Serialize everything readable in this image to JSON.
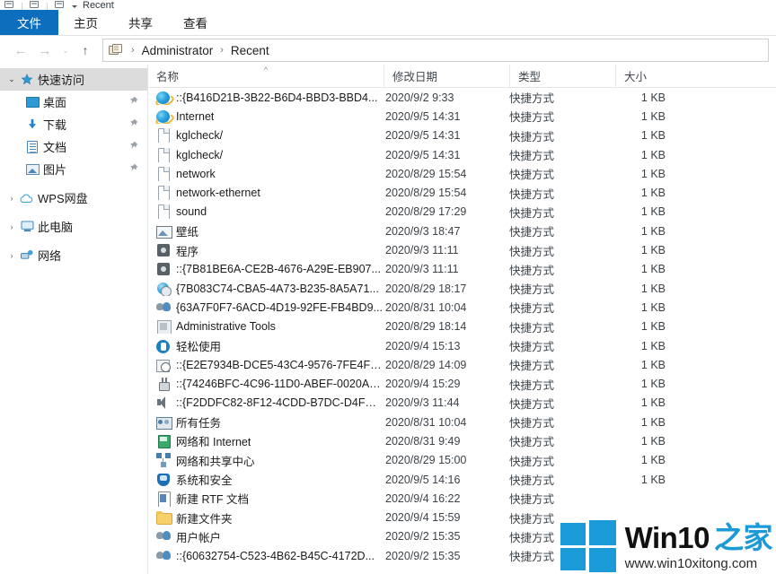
{
  "titlebar": {
    "window_title": "Recent",
    "qat_dropdown": "▾"
  },
  "ribbon": {
    "tabs": [
      {
        "label": "文件",
        "active": true
      },
      {
        "label": "主页",
        "active": false
      },
      {
        "label": "共享",
        "active": false
      },
      {
        "label": "查看",
        "active": false
      }
    ]
  },
  "addressbar": {
    "back": "←",
    "forward": "→",
    "recent_dropdown": "⌄",
    "up": "↑",
    "breadcrumbs": [
      "Administrator",
      "Recent"
    ],
    "separator": "›"
  },
  "sidebar": {
    "items": [
      {
        "label": "快速访问",
        "icon": "star-icon",
        "chevron": "⌄",
        "level": 0,
        "selected": true,
        "pinned": false
      },
      {
        "label": "桌面",
        "icon": "desktop-icon",
        "chevron": "",
        "level": 1,
        "selected": false,
        "pinned": true
      },
      {
        "label": "下载",
        "icon": "download-icon",
        "chevron": "",
        "level": 1,
        "selected": false,
        "pinned": true
      },
      {
        "label": "文档",
        "icon": "document-icon",
        "chevron": "",
        "level": 1,
        "selected": false,
        "pinned": true
      },
      {
        "label": "图片",
        "icon": "pictures-icon",
        "chevron": "",
        "level": 1,
        "selected": false,
        "pinned": true
      },
      {
        "label": "WPS网盘",
        "icon": "cloud-icon",
        "chevron": "›",
        "level": 0,
        "selected": false,
        "pinned": false
      },
      {
        "label": "此电脑",
        "icon": "this-pc-icon",
        "chevron": "›",
        "level": 0,
        "selected": false,
        "pinned": false
      },
      {
        "label": "网络",
        "icon": "network-icon",
        "chevron": "›",
        "level": 0,
        "selected": false,
        "pinned": false
      }
    ],
    "pin_glyph": "📌"
  },
  "columns": {
    "name": "名称",
    "date": "修改日期",
    "type": "类型",
    "size": "大小",
    "sort_arrow": "^"
  },
  "files": [
    {
      "name": "::{B416D21B-3B22-B6D4-BBD3-BBD4...",
      "date": "2020/9/2 9:33",
      "type": "快捷方式",
      "size": "1 KB",
      "icon": "internet-explorer-icon"
    },
    {
      "name": "Internet",
      "date": "2020/9/5 14:31",
      "type": "快捷方式",
      "size": "1 KB",
      "icon": "internet-explorer-icon"
    },
    {
      "name": "kglcheck/",
      "date": "2020/9/5 14:31",
      "type": "快捷方式",
      "size": "1 KB",
      "icon": "generic-file-icon"
    },
    {
      "name": "kglcheck/",
      "date": "2020/9/5 14:31",
      "type": "快捷方式",
      "size": "1 KB",
      "icon": "generic-file-icon"
    },
    {
      "name": "network",
      "date": "2020/8/29 15:54",
      "type": "快捷方式",
      "size": "1 KB",
      "icon": "generic-file-icon"
    },
    {
      "name": "network-ethernet",
      "date": "2020/8/29 15:54",
      "type": "快捷方式",
      "size": "1 KB",
      "icon": "generic-file-icon"
    },
    {
      "name": "sound",
      "date": "2020/8/29 17:29",
      "type": "快捷方式",
      "size": "1 KB",
      "icon": "generic-file-icon"
    },
    {
      "name": "壁纸",
      "date": "2020/9/3 18:47",
      "type": "快捷方式",
      "size": "1 KB",
      "icon": "wallpaper-icon"
    },
    {
      "name": "程序",
      "date": "2020/9/3 11:11",
      "type": "快捷方式",
      "size": "1 KB",
      "icon": "programs-icon"
    },
    {
      "name": "::{7B81BE6A-CE2B-4676-A29E-EB907...",
      "date": "2020/9/3 11:11",
      "type": "快捷方式",
      "size": "1 KB",
      "icon": "programs-icon"
    },
    {
      "name": "{7B083C74-CBA5-4A73-B235-8A5A71...",
      "date": "2020/8/29 18:17",
      "type": "快捷方式",
      "size": "1 KB",
      "icon": "globe-icon"
    },
    {
      "name": "{63A7F0F7-6ACD-4D19-92FE-FB4BD9...",
      "date": "2020/8/31 10:04",
      "type": "快捷方式",
      "size": "1 KB",
      "icon": "users-icon"
    },
    {
      "name": "Administrative Tools",
      "date": "2020/8/29 18:14",
      "type": "快捷方式",
      "size": "1 KB",
      "icon": "administrative-tools-icon"
    },
    {
      "name": "轻松使用",
      "date": "2020/9/4 15:13",
      "type": "快捷方式",
      "size": "1 KB",
      "icon": "ease-of-access-icon"
    },
    {
      "name": "::{E2E7934B-DCE5-43C4-9576-7FE4F7...",
      "date": "2020/8/29 14:09",
      "type": "快捷方式",
      "size": "1 KB",
      "icon": "date-time-icon"
    },
    {
      "name": "::{74246BFC-4C96-11D0-ABEF-0020AF...",
      "date": "2020/9/4 15:29",
      "type": "快捷方式",
      "size": "1 KB",
      "icon": "device-icon"
    },
    {
      "name": "::{F2DDFC82-8F12-4CDD-B7DC-D4FE1...",
      "date": "2020/9/3 11:44",
      "type": "快捷方式",
      "size": "1 KB",
      "icon": "sound-icon"
    },
    {
      "name": "所有任务",
      "date": "2020/8/31 10:04",
      "type": "快捷方式",
      "size": "1 KB",
      "icon": "all-tasks-icon"
    },
    {
      "name": "网络和 Internet",
      "date": "2020/8/31 9:49",
      "type": "快捷方式",
      "size": "1 KB",
      "icon": "network-internet-icon"
    },
    {
      "name": "网络和共享中心",
      "date": "2020/8/29 15:00",
      "type": "快捷方式",
      "size": "1 KB",
      "icon": "network-sharing-icon"
    },
    {
      "name": "系统和安全",
      "date": "2020/9/5 14:16",
      "type": "快捷方式",
      "size": "1 KB",
      "icon": "system-security-icon"
    },
    {
      "name": "新建 RTF 文档",
      "date": "2020/9/4 16:22",
      "type": "快捷方式",
      "size": "",
      "icon": "rtf-document-icon"
    },
    {
      "name": "新建文件夹",
      "date": "2020/9/4 15:59",
      "type": "快捷方式",
      "size": "",
      "icon": "folder-icon"
    },
    {
      "name": "用户帐户",
      "date": "2020/9/2 15:35",
      "type": "快捷方式",
      "size": "",
      "icon": "user-accounts-icon"
    },
    {
      "name": "::{60632754-C523-4B62-B45C-4172D...",
      "date": "2020/9/2 15:35",
      "type": "快捷方式",
      "size": "",
      "icon": "user-accounts-icon"
    }
  ],
  "watermark": {
    "brand": "Win10",
    "brand_cn": "之家",
    "url": "www.win10xitong.com"
  },
  "scrollbar": {
    "up": "▲",
    "down": "▼"
  }
}
